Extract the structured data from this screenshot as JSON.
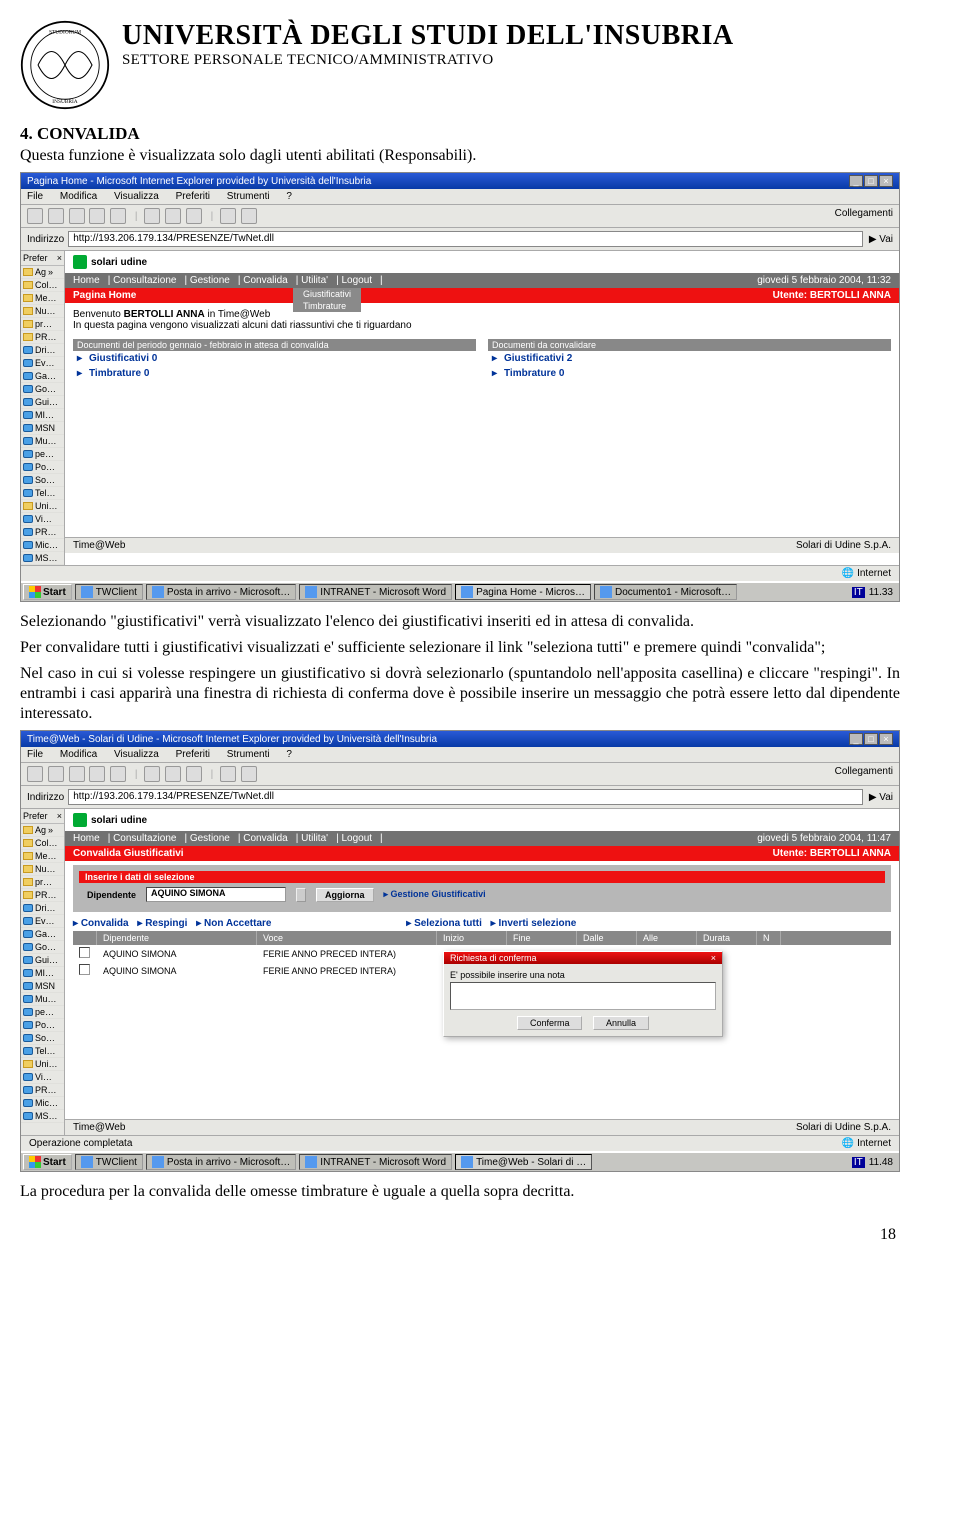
{
  "header": {
    "title": "UNIVERSITÀ DEGLI STUDI DELL'INSUBRIA",
    "subtitle": "SETTORE PERSONALE TECNICO/AMMINISTRATIVO"
  },
  "section": {
    "heading": "4.  CONVALIDA",
    "intro": "Questa funzione è visualizzata solo dagli utenti abilitati (Responsabili).",
    "p1": "Selezionando \"giustificativi\" verrà visualizzato l'elenco dei giustificativi inseriti ed in attesa di convalida.",
    "p2": "Per convalidare tutti i giustificativi visualizzati e' sufficiente selezionare il link \"seleziona tutti\" e premere quindi \"convalida\";",
    "p3": "Nel caso in cui si volesse respingere un giustificativo si dovrà selezionarlo (spuntandolo nell'apposita casellina) e cliccare \"respingi\". In entrambi i casi apparirà una finestra di richiesta di conferma dove è possibile inserire un messaggio che potrà essere letto dal dipendente interessato.",
    "closing": "La procedura per la convalida delle omesse timbrature è uguale a quella sopra decritta."
  },
  "ie": {
    "title1": "Pagina Home - Microsoft Internet Explorer provided by Università dell'Insubria",
    "title2": "Time@Web - Solari di Udine - Microsoft Internet Explorer provided by Università dell'Insubria",
    "menu": [
      "File",
      "Modifica",
      "Visualizza",
      "Preferiti",
      "Strumenti",
      "?"
    ],
    "addr_label": "Indirizzo",
    "url": "http://193.206.179.134/PRESENZE/TwNet.dll",
    "collegamenti": "Collegamenti",
    "vai": "Vai",
    "prefer": "Prefer",
    "status_done": "Operazione completata",
    "internet": "Internet"
  },
  "favs": [
    "Ag",
    "Col…",
    "Me…",
    "Nu…",
    "pr…",
    "PR…",
    "Dri…",
    "Ev…",
    "Ga…",
    "Go…",
    "Gui…",
    "MI…",
    "MSN",
    "Mu…",
    "pe…",
    "Po…",
    "So…",
    "Tel…",
    "Uni…",
    "Vi…",
    "PR…",
    "Mic…",
    "MS…"
  ],
  "app": {
    "brand": "solari  udine",
    "nav": [
      "Home",
      "Consultazione",
      "Gestione",
      "Convalida",
      "Utilita'",
      "Logout"
    ],
    "date1": "giovedi 5 febbraio 2004, 11:32",
    "date2": "giovedi 5 febbraio 2004, 11:47",
    "page1_title": "Pagina Home",
    "page2_title": "Convalida Giustificativi",
    "user_label": "Utente: BERTOLLI ANNA",
    "submenu": [
      "Giustificativi",
      "Timbrature"
    ],
    "welcome1": "Benvenuto BERTOLLI ANNA in Time@Web",
    "welcome2": "In questa pagina vengono visualizzati alcuni dati riassuntivi che ti riguardano",
    "docs_left_header": "Documenti del periodo gennaio - febbraio in attesa di convalida",
    "docs_right_header": "Documenti da convalidare",
    "doc_left": [
      "Giustificativi 0",
      "Timbrature 0"
    ],
    "doc_right": [
      "Giustificativi 2",
      "Timbrature 0"
    ],
    "footer_left": "Time@Web",
    "footer_right": "Solari di Udine S.p.A."
  },
  "form": {
    "header": "Inserire i dati di selezione",
    "dip_label": "Dipendente",
    "dip_value": "AQUINO SIMONA",
    "aggiorna": "Aggiorna",
    "gest": "Gestione Giustificativi",
    "links": [
      "Convalida",
      "Respingi",
      "Non Accettare",
      "Seleziona tutti",
      "Inverti selezione"
    ],
    "cols": [
      "",
      "Dipendente",
      "Voce",
      "Inizio",
      "Fine",
      "Dalle",
      "Alle",
      "Durata",
      "N"
    ],
    "rows": [
      {
        "dip": "AQUINO SIMONA",
        "voce": "FERIE ANNO PRECED INTERA)"
      },
      {
        "dip": "AQUINO SIMONA",
        "voce": "FERIE ANNO PRECED INTERA)"
      }
    ]
  },
  "dialog": {
    "title": "Richiesta di conferma",
    "msg": "E' possibile inserire una nota",
    "conferma": "Conferma",
    "annulla": "Annulla"
  },
  "taskbar": {
    "start": "Start",
    "tasks1": [
      "TWClient",
      "Posta in arrivo - Microsoft…",
      "INTRANET - Microsoft Word",
      "Pagina Home - Micros…",
      "Documento1 - Microsoft…"
    ],
    "tasks2": [
      "TWClient",
      "Posta in arrivo - Microsoft…",
      "INTRANET - Microsoft Word",
      "Time@Web - Solari di …"
    ],
    "lang": "IT",
    "time1": "11.33",
    "time2": "11.48"
  },
  "page_number": "18"
}
